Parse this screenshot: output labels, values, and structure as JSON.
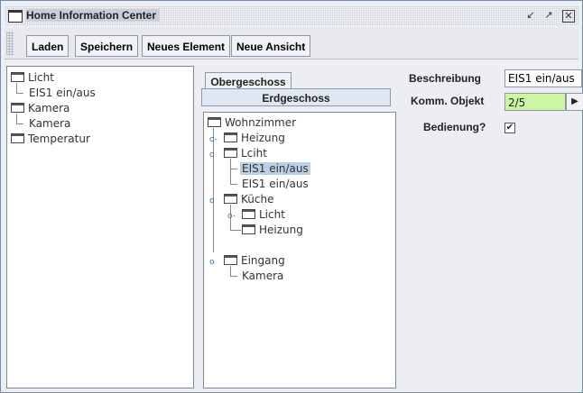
{
  "window": {
    "title": "Home Information Center"
  },
  "toolbar": {
    "load_label": "Laden",
    "save_label": "Speichern",
    "new_element_label": "Neues Element",
    "new_view_label": "Neue Ansicht"
  },
  "left_tree": {
    "items": [
      {
        "label": "Licht",
        "type": "folder"
      },
      {
        "label": "EIS1 ein/aus",
        "type": "leaf"
      },
      {
        "label": "Kamera",
        "type": "folder"
      },
      {
        "label": "Kamera",
        "type": "leaf"
      },
      {
        "label": "Temperatur",
        "type": "folder"
      }
    ]
  },
  "tabs": {
    "back": "Obergeschoss",
    "front": "Erdgeschoss"
  },
  "view_tree": {
    "items": [
      {
        "label": "Wohnzimmer"
      },
      {
        "label": "Heizung"
      },
      {
        "label": "Lciht"
      },
      {
        "label": "EIS1 ein/aus",
        "selected": true
      },
      {
        "label": "EIS1 ein/aus"
      },
      {
        "label": "Küche"
      },
      {
        "label": "Licht"
      },
      {
        "label": "Heizung"
      },
      {
        "label": "Eingang"
      },
      {
        "label": "Kamera"
      }
    ]
  },
  "properties": {
    "description_label": "Beschreibung",
    "description_value": "EIS1 ein/aus",
    "comm_object_label": "Komm. Objekt",
    "comm_object_value": "2/5",
    "operation_label": "Bedienung?",
    "operation_checked": true,
    "check_mark": "✔"
  },
  "icons": {
    "minimize": "▫",
    "maximize": "▫",
    "close": "✕",
    "arrow_right": "▶",
    "collapsed_toggle": "o-",
    "expanded_toggle": "o"
  },
  "colors": {
    "selection": "#b8cfe5",
    "comm_object_bg": "#ccf5a6",
    "active_tab": "#dfe7f3"
  }
}
